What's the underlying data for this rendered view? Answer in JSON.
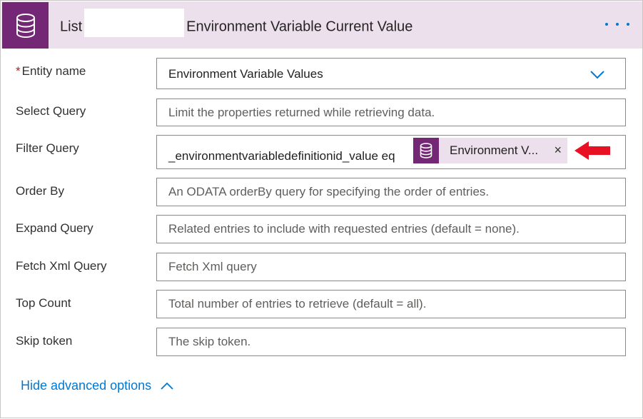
{
  "header": {
    "title_prefix": "List",
    "title_suffix": "Environment Variable Current Value",
    "icon": "database-icon",
    "more_icon": "more-options-icon",
    "bg_color": "#ece0ec",
    "icon_color": "#742774"
  },
  "fields": {
    "entity_name": {
      "label": "Entity name",
      "required_mark": "*",
      "value": "Environment Variable Values",
      "icon": "chevron-down-icon"
    },
    "select_query": {
      "label": "Select Query",
      "placeholder": "Limit the properties returned while retrieving data."
    },
    "filter_query": {
      "label": "Filter Query",
      "text": "_environmentvariabledefinitionid_value eq",
      "token_label": "Environment V...",
      "token_close": "×",
      "token_icon": "database-icon"
    },
    "order_by": {
      "label": "Order By",
      "placeholder": "An ODATA orderBy query for specifying the order of entries."
    },
    "expand_query": {
      "label": "Expand Query",
      "placeholder": "Related entries to include with requested entries (default = none)."
    },
    "fetch_xml_query": {
      "label": "Fetch Xml Query",
      "placeholder": "Fetch Xml query"
    },
    "top_count": {
      "label": "Top Count",
      "placeholder": "Total number of entries to retrieve (default = all)."
    },
    "skip_token": {
      "label": "Skip token",
      "placeholder": "The skip token."
    }
  },
  "advanced": {
    "label": "Hide advanced options",
    "icon": "chevron-up-icon"
  },
  "annotation": {
    "icon": "red-arrow-icon",
    "color": "#e81123"
  },
  "colors": {
    "link": "#0078d4",
    "required": "#a4262c"
  }
}
